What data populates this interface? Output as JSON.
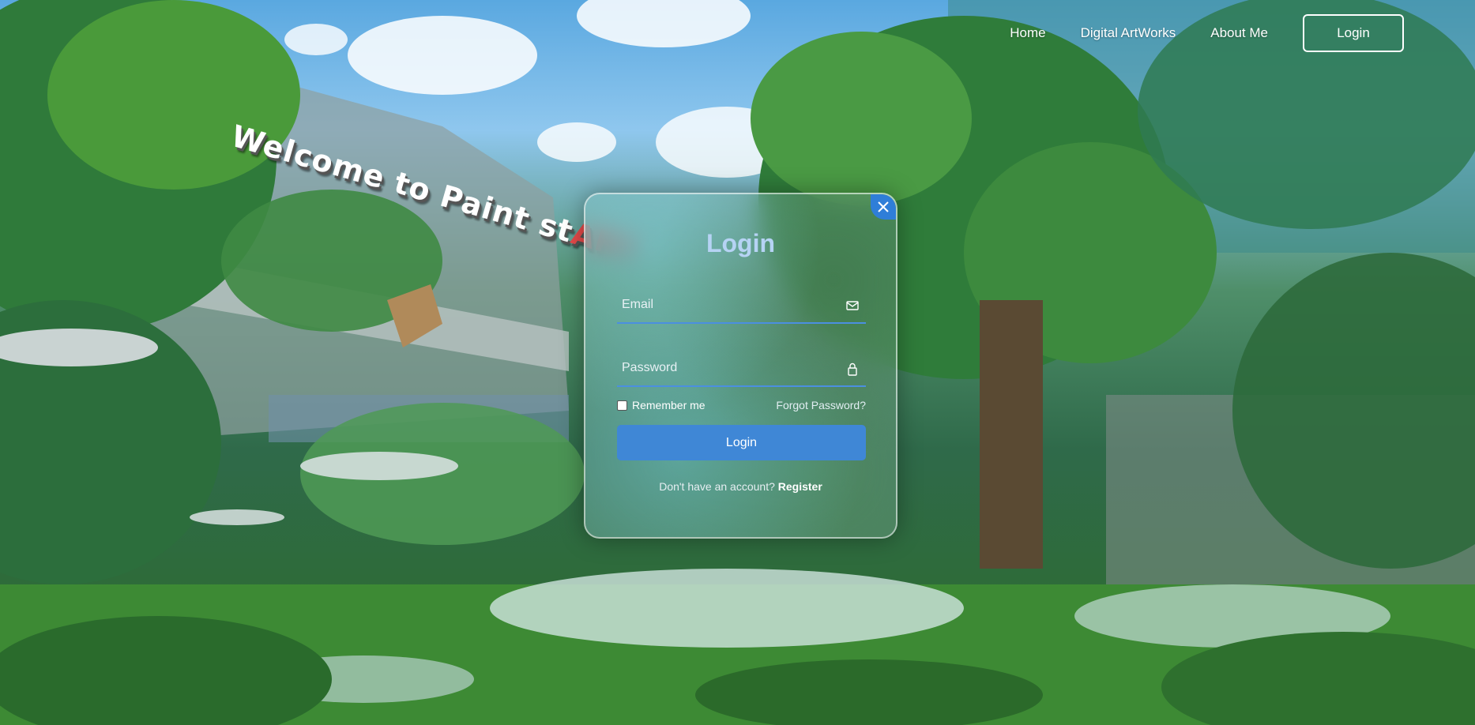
{
  "nav": {
    "items": [
      {
        "label": "Home"
      },
      {
        "label": "Digital ArtWorks"
      },
      {
        "label": "About Me"
      }
    ],
    "login_label": "Login"
  },
  "hero": {
    "welcome_prefix": "Welcome to Paint st",
    "welcome_highlight": "ART"
  },
  "login_modal": {
    "title": "Login",
    "email_placeholder": "Email",
    "email_icon": "envelope-icon",
    "password_placeholder": "Password",
    "password_icon": "lock-icon",
    "remember_label": "Remember me",
    "forgot_label": "Forgot Password?",
    "submit_label": "Login",
    "register_prompt": "Don't have an account?",
    "register_link": "Register",
    "close_icon": "close-icon"
  },
  "colors": {
    "accent": "#3f87d6",
    "title": "#b6d3f4",
    "highlight": "#e84a4a"
  }
}
